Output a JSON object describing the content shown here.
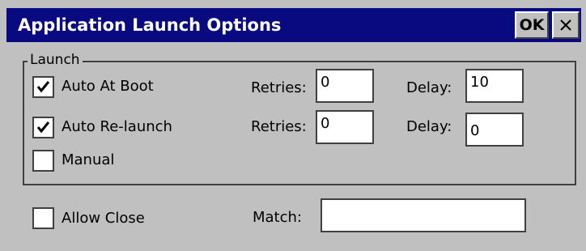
{
  "window": {
    "title": "Application Launch Options",
    "ok_label": "OK",
    "close_icon": "close-icon"
  },
  "launch": {
    "group_label": "Launch",
    "rows": [
      {
        "label": "Auto At Boot",
        "checked": true,
        "retries_label": "Retries:",
        "retries_value": "0",
        "delay_label": "Delay:",
        "delay_value": "10"
      },
      {
        "label": "Auto Re-launch",
        "checked": true,
        "retries_label": "Retries:",
        "retries_value": "0",
        "delay_label": "Delay:",
        "delay_value": "0"
      },
      {
        "label": "Manual",
        "checked": false
      }
    ]
  },
  "allow_close": {
    "label": "Allow Close",
    "checked": false,
    "match_label": "Match:",
    "match_value": ""
  },
  "colors": {
    "titlebar": "#0a0a80",
    "window": "#c0c0c0",
    "field": "#ffffff"
  }
}
